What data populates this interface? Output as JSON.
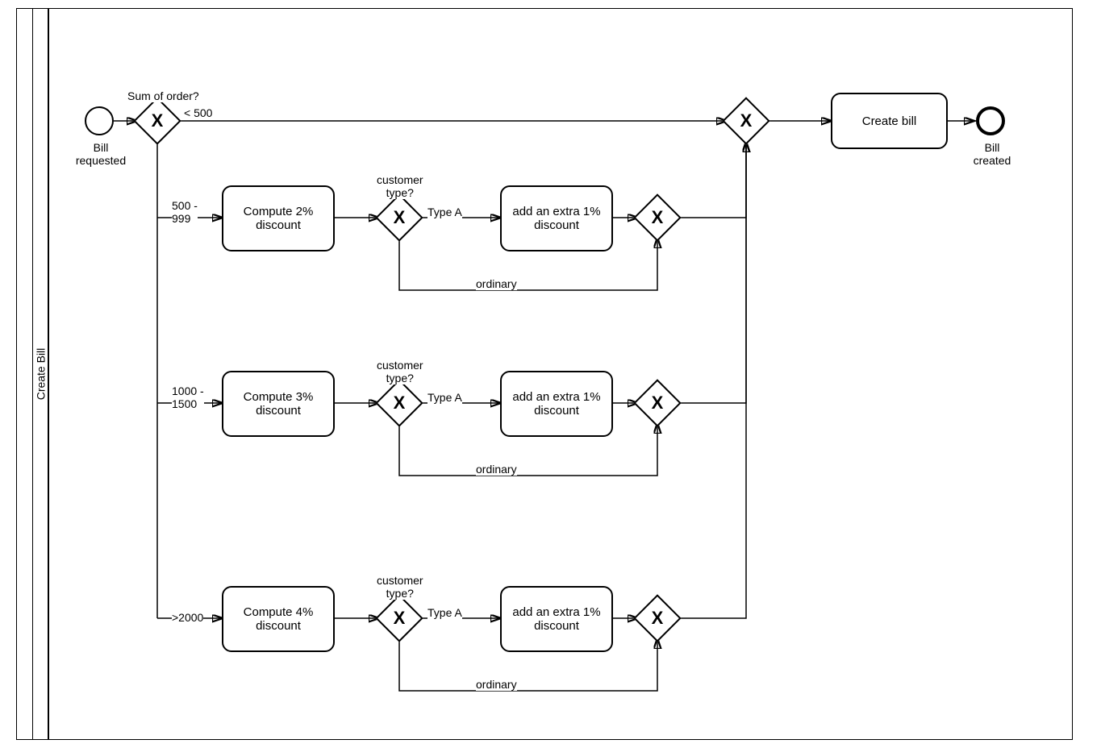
{
  "lane": {
    "title": "Create Bill"
  },
  "events": {
    "start_label": "Bill\nrequested",
    "end_label": "Bill\ncreated"
  },
  "tasks": {
    "compute2": "Compute 2%\ndiscount",
    "compute3": "Compute 3%\ndiscount",
    "compute4": "Compute 4%\ndiscount",
    "extra1_a": "add an extra 1%\ndiscount",
    "extra1_b": "add an extra 1%\ndiscount",
    "extra1_c": "add an extra 1%\ndiscount",
    "create_bill": "Create bill"
  },
  "gateway_labels": {
    "sum_of_order": "Sum of order?",
    "customer_type_a": "customer\ntype?",
    "customer_type_b": "customer\ntype?",
    "customer_type_c": "customer\ntype?"
  },
  "edges": {
    "lt500": "< 500",
    "r500": "500 -\n999",
    "r1000": "1000 -\n1500",
    "gt2000": ">2000",
    "typeA_a": "Type A",
    "typeA_b": "Type A",
    "typeA_c": "Type A",
    "ordinary_a": "ordinary",
    "ordinary_b": "ordinary",
    "ordinary_c": "ordinary"
  }
}
